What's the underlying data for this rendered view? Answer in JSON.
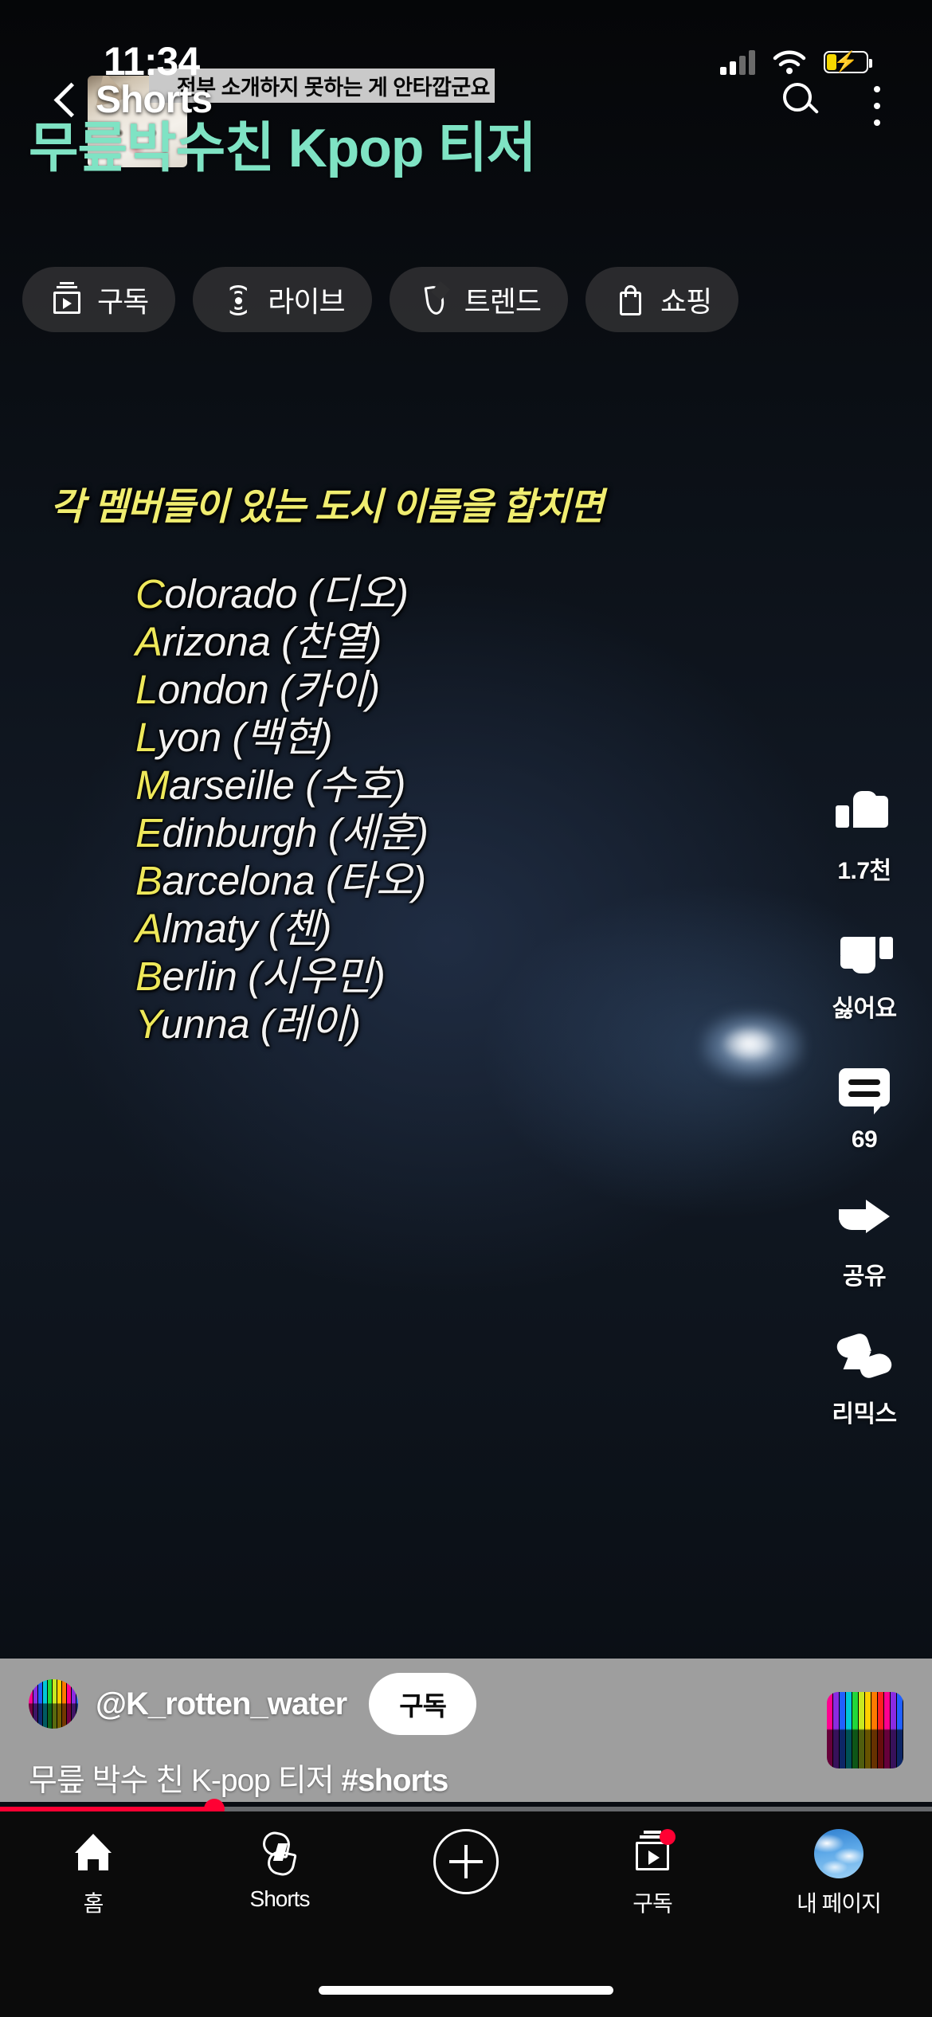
{
  "status_bar": {
    "time": "11:34",
    "signal_icon": "cellular-signal-icon",
    "wifi_icon": "wifi-icon",
    "battery_icon": "battery-charging-icon"
  },
  "top_bar": {
    "back_icon": "back-chevron-icon",
    "title": "Shorts",
    "search_icon": "search-icon",
    "more_icon": "more-vertical-icon"
  },
  "chips": [
    {
      "label": "구독",
      "icon": "subscriptions-icon"
    },
    {
      "label": "라이브",
      "icon": "live-broadcast-icon"
    },
    {
      "label": "트렌드",
      "icon": "trending-flame-icon"
    },
    {
      "label": "쇼핑",
      "icon": "shopping-bag-icon"
    }
  ],
  "video": {
    "caption_overlay": "전부 소개하지 못하는 게 안타깝군요",
    "mint_title": "무릎박수친 Kpop 티저",
    "heading": "각 멤버들이 있는 도시 이름을 합치면",
    "city_list": [
      {
        "initial": "C",
        "rest": "olorado",
        "korean": "(디오)"
      },
      {
        "initial": "A",
        "rest": "rizona",
        "korean": "(찬열)"
      },
      {
        "initial": "L",
        "rest": "ondon",
        "korean": "(카이)"
      },
      {
        "initial": "L",
        "rest": "yon",
        "korean": "(백현)"
      },
      {
        "initial": "M",
        "rest": "arseille",
        "korean": "(수호)"
      },
      {
        "initial": "E",
        "rest": "dinburgh",
        "korean": "(세훈)"
      },
      {
        "initial": "B",
        "rest": "arcelona",
        "korean": "(타오)"
      },
      {
        "initial": "A",
        "rest": "lmaty",
        "korean": "(첸)"
      },
      {
        "initial": "B",
        "rest": "erlin",
        "korean": "(시우민)"
      },
      {
        "initial": "Y",
        "rest": "unna",
        "korean": "(레이)"
      }
    ]
  },
  "action_rail": [
    {
      "name": "like",
      "icon": "thumbs-up-icon",
      "label": "1.7천"
    },
    {
      "name": "dislike",
      "icon": "thumbs-down-icon",
      "label": "싫어요"
    },
    {
      "name": "comments",
      "icon": "comment-bubble-icon",
      "label": "69"
    },
    {
      "name": "share",
      "icon": "share-arrow-icon",
      "label": "공유"
    },
    {
      "name": "remix",
      "icon": "remix-icon",
      "label": "리믹스"
    }
  ],
  "meta": {
    "avatar_icon": "channel-avatar",
    "channel_handle": "@K_rotten_water",
    "subscribe_label": "구독",
    "title_plain": "무릎 박수 친 K-pop 티저 ",
    "title_hashtag": "#shorts",
    "music_thumb_icon": "sound-thumbnail"
  },
  "progress": {
    "percent": 23,
    "played_color": "#ff0033",
    "track_color": "rgba(255,255,255,0.38)"
  },
  "bottom_nav": [
    {
      "label": "홈",
      "icon": "home-icon"
    },
    {
      "label": "Shorts",
      "icon": "shorts-icon"
    },
    {
      "label": "",
      "icon": "create-plus-icon"
    },
    {
      "label": "구독",
      "icon": "subscriptions-icon",
      "badge": true
    },
    {
      "label": "내 페이지",
      "icon": "my-page-avatar-icon"
    }
  ],
  "colors": {
    "accent_red": "#ff0033",
    "mint": "#7fe3c4",
    "yellow": "#eee85a",
    "chip_bg": "rgba(46,46,48,0.92)",
    "meta_panel": "#9e9e9e"
  }
}
